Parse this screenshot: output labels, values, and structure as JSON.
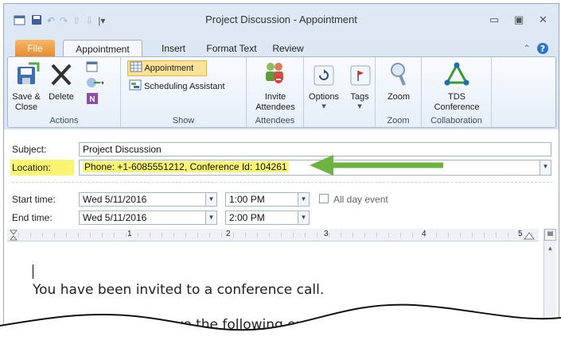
{
  "window": {
    "title": "Project Discussion - Appointment",
    "qat_icons": [
      "calendar-icon",
      "save-icon",
      "undo-icon",
      "redo-icon",
      "up-arrow-icon",
      "down-arrow-icon",
      "customize-qat-icon"
    ]
  },
  "tabs": [
    "File",
    "Appointment",
    "Insert",
    "Format Text",
    "Review"
  ],
  "ribbon": {
    "actions": {
      "save_close": "Save &\nClose",
      "delete": "Delete",
      "label": "Actions"
    },
    "show": {
      "appointment": "Appointment",
      "scheduling": "Scheduling Assistant",
      "label": "Show"
    },
    "attendees": {
      "invite": "Invite\nAttendees",
      "label": "Attendees"
    },
    "options": {
      "options": "Options",
      "tags": "Tags"
    },
    "zoom": {
      "zoom": "Zoom",
      "label": "Zoom"
    },
    "collab": {
      "tds": "TDS\nConference",
      "label": "Collaboration"
    }
  },
  "form": {
    "subject_label": "Subject:",
    "subject_value": "Project Discussion",
    "location_label": "Location:",
    "location_value": "Phone: +1-6085551212, Conference Id: 104261",
    "start_label": "Start time:",
    "start_date": "Wed 5/11/2016",
    "start_time": "1:00 PM",
    "allday_label": "All day event",
    "end_label": "End time:",
    "end_date": "Wed 5/11/2016",
    "end_time": "2:00 PM"
  },
  "ruler_numbers": [
    "1",
    "2",
    "3",
    "4",
    "5"
  ],
  "body": {
    "line1": "You have been invited to a conference call.",
    "line2": "have the following op"
  },
  "colors": {
    "highlight": "#f9f571",
    "arrow": "#6cb33f",
    "file_tab": "#e68a29"
  }
}
